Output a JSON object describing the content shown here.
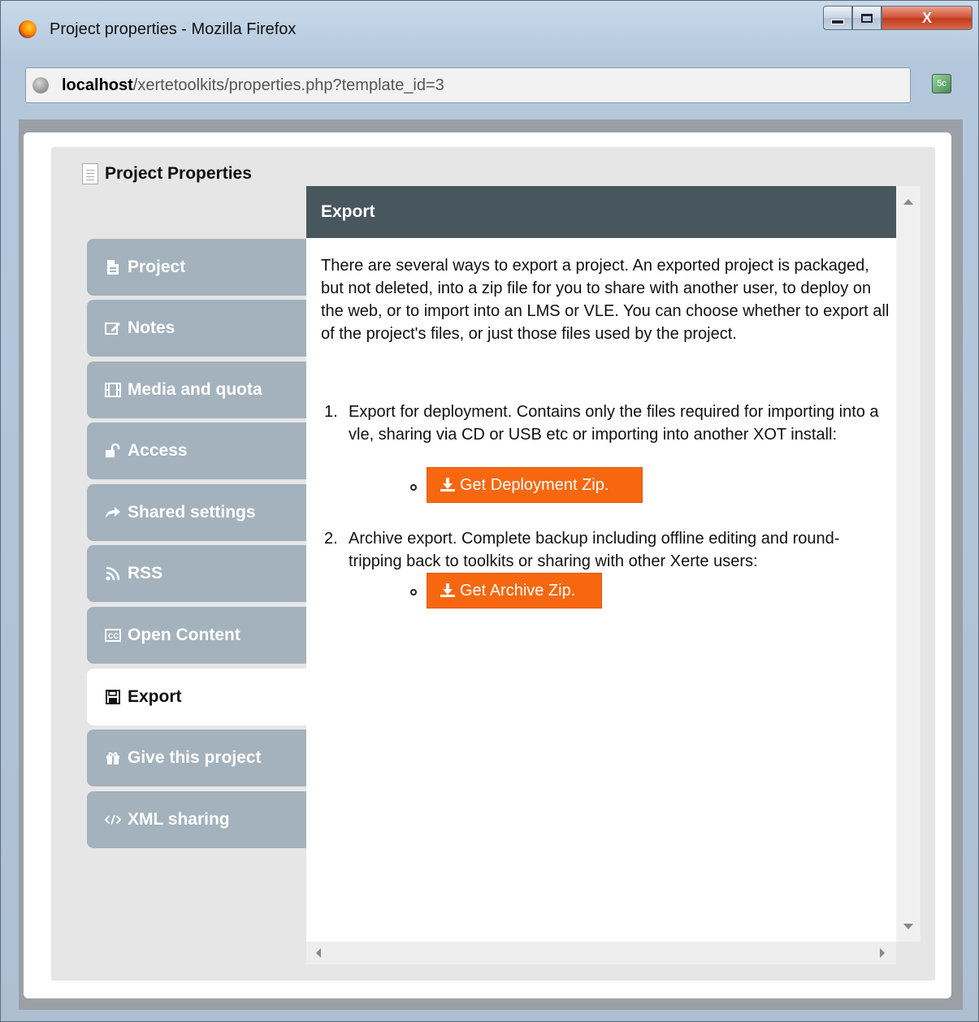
{
  "window": {
    "title": "Project properties - Mozilla Firefox",
    "close_label": "X"
  },
  "address": {
    "host": "localhost",
    "path": "/xertetoolkits/properties.php?template_id=3"
  },
  "page": {
    "title": "Project Properties"
  },
  "tabs": [
    {
      "label": "Project",
      "icon": "document-icon"
    },
    {
      "label": "Notes",
      "icon": "edit-icon"
    },
    {
      "label": "Media and quota",
      "icon": "film-icon"
    },
    {
      "label": "Access",
      "icon": "unlock-icon"
    },
    {
      "label": "Shared settings",
      "icon": "share-icon"
    },
    {
      "label": "RSS",
      "icon": "rss-icon"
    },
    {
      "label": "Open Content",
      "icon": "cc-icon"
    },
    {
      "label": "Export",
      "icon": "save-icon"
    },
    {
      "label": "Give this project",
      "icon": "gift-icon"
    },
    {
      "label": "XML sharing",
      "icon": "code-icon"
    }
  ],
  "active_tab": "Export",
  "content": {
    "header": "Export",
    "intro": "There are several ways to export a project. An exported project is packaged, but not deleted, into a zip file for you to share with another user, to deploy on the web, or to import into an LMS or VLE. You can choose whether to export all of the project's files, or just those files used by the project.",
    "items": [
      {
        "number": "1.",
        "text": "Export for deployment. Contains only the files required for importing into a vle, sharing via CD or USB etc or importing into another XOT install:",
        "button": "Get Deployment Zip."
      },
      {
        "number": "2.",
        "text": "Archive export. Complete backup including offline editing and round-tripping back to toolkits or sharing with other Xerte users:",
        "button": "Get Archive Zip."
      }
    ]
  },
  "colors": {
    "tab_bg": "#a3b2bd",
    "header_bg": "#48565e",
    "button_orange": "#f7670f"
  }
}
